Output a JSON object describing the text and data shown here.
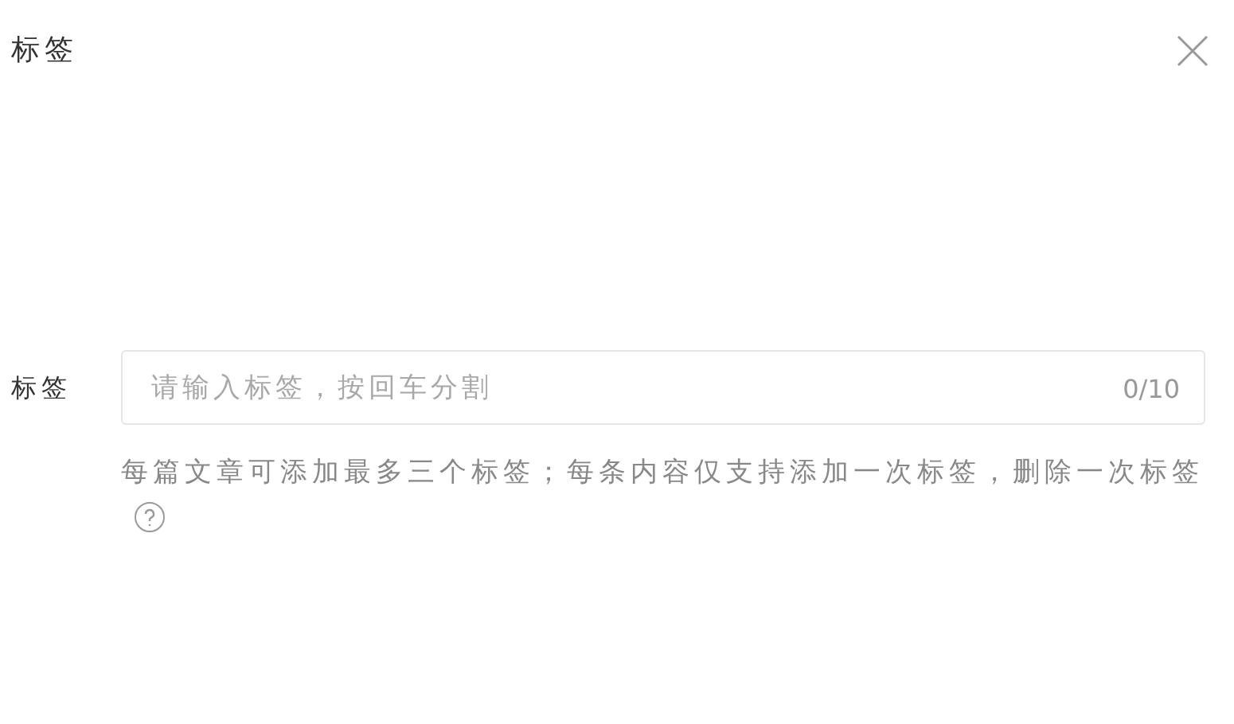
{
  "dialog": {
    "title": "标签"
  },
  "tag_field": {
    "label": "标签",
    "placeholder": "请输入标签，按回车分割",
    "counter": "0/10"
  },
  "help_text": "每篇文章可添加最多三个标签；每条内容仅支持添加一次标签，删除一次标签"
}
